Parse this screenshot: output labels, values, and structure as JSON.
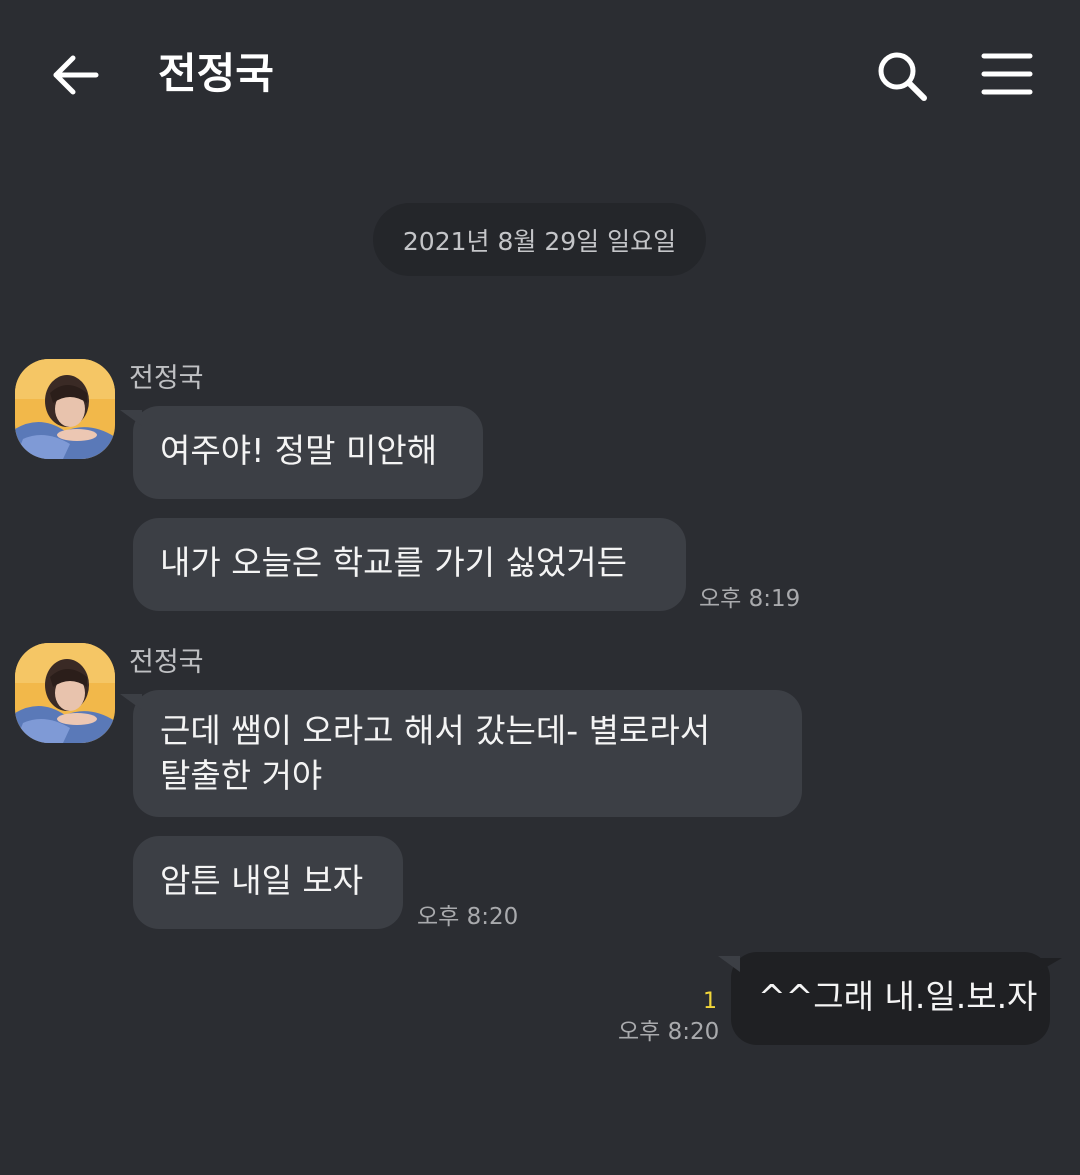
{
  "header": {
    "title": "전정국"
  },
  "date_divider": "2021년 8월 29일 일요일",
  "messages": {
    "group1": {
      "sender": "전정국",
      "bubble1": "여주야! 정말 미안해",
      "bubble2": "내가 오늘은 학교를 가기 싫었거든",
      "time": "오후 8:19"
    },
    "group2": {
      "sender": "전정국",
      "bubble1_line1": "근데 쌤이 오라고 해서 갔는데- 별로라서",
      "bubble1_line2": "탈출한 거야",
      "bubble2": "암튼 내일 보자",
      "time": "오후 8:20"
    },
    "mine": {
      "unread_count": "1",
      "time": "오후 8:20",
      "text": "^^그래 내.일.보.자"
    }
  },
  "icons": {
    "back": "arrow-left-icon",
    "search": "search-icon",
    "menu": "hamburger-menu-icon"
  },
  "colors": {
    "background": "#2b2d32",
    "incoming_bubble": "#3c3f45",
    "outgoing_bubble": "#1f2023",
    "unread": "#f2d63a"
  }
}
